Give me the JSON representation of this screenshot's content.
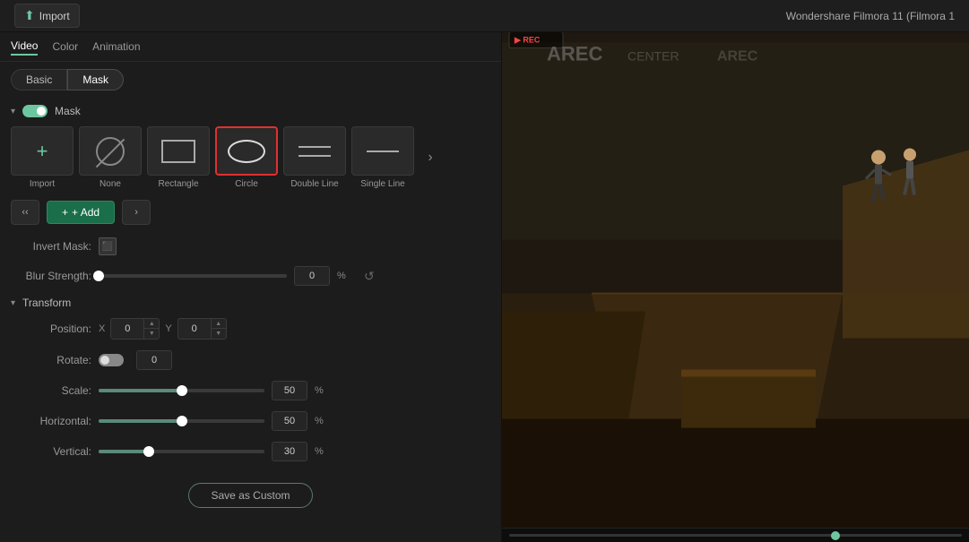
{
  "app": {
    "title": "Wondershare Filmora 11 (Filmora 1"
  },
  "topbar": {
    "import_label": "Import"
  },
  "tabs": {
    "video": "Video",
    "color": "Color",
    "animation": "Animation"
  },
  "subtabs": {
    "basic": "Basic",
    "mask": "Mask"
  },
  "mask_section": {
    "label": "Mask"
  },
  "shapes": [
    {
      "id": "import",
      "label": "Import"
    },
    {
      "id": "none",
      "label": "None"
    },
    {
      "id": "rectangle",
      "label": "Rectangle"
    },
    {
      "id": "circle",
      "label": "Circle"
    },
    {
      "id": "double-line",
      "label": "Double Line"
    },
    {
      "id": "single-line",
      "label": "Single Line"
    }
  ],
  "actions": {
    "add_label": "+ Add"
  },
  "properties": {
    "invert_mask_label": "Invert Mask:",
    "blur_strength_label": "Blur Strength:",
    "blur_value": "0",
    "blur_unit": "%",
    "transform_label": "Transform",
    "position_label": "Position:",
    "position_x_label": "X",
    "position_x_value": "0",
    "position_y_label": "Y",
    "position_y_value": "0",
    "rotate_label": "Rotate:",
    "rotate_value": "0",
    "scale_label": "Scale:",
    "scale_value": "50",
    "scale_unit": "%",
    "horizontal_label": "Horizontal:",
    "horizontal_value": "50",
    "horizontal_unit": "%",
    "vertical_label": "Vertical:",
    "vertical_value": "30",
    "vertical_unit": "%"
  },
  "save_button": {
    "label": "Save as Custom"
  },
  "sliders": {
    "blur_percent": 0,
    "scale_percent": 50,
    "horizontal_percent": 50,
    "vertical_percent": 30
  }
}
